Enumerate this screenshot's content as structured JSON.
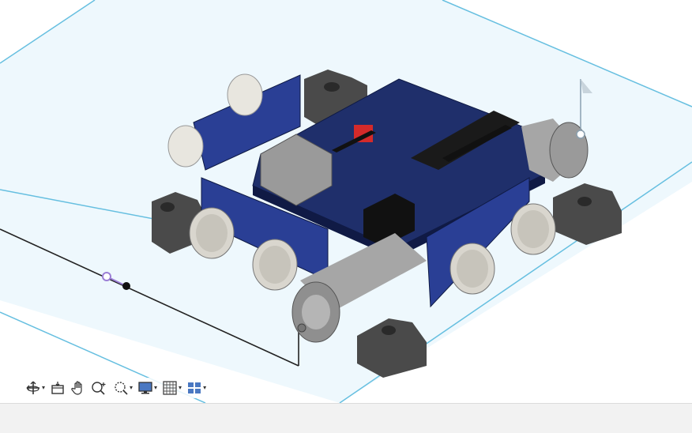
{
  "viewport": {
    "background_color": "#ffffff",
    "ground_plane_color": "#e9f6fc",
    "ground_plane_edge_color": "#5bb8dc",
    "model": {
      "board_color": "#1f2f6b",
      "sensor_color": "#e8e6df",
      "motor_color": "#a6a6a6",
      "wheel_mount_color": "#4a4a4a"
    }
  },
  "navigation_toolbar": {
    "tools": [
      {
        "icon": "orbit-icon",
        "dropdown": true
      },
      {
        "icon": "look-at-icon",
        "dropdown": false
      },
      {
        "icon": "pan-hand-icon",
        "dropdown": false
      },
      {
        "icon": "zoom-icon",
        "dropdown": false
      },
      {
        "icon": "fit-window-icon",
        "dropdown": true
      },
      {
        "icon": "display-settings-icon",
        "dropdown": true
      },
      {
        "icon": "grid-snaps-icon",
        "dropdown": true
      },
      {
        "icon": "viewports-icon",
        "dropdown": true
      }
    ]
  },
  "status_bar": {
    "background_color": "#f2f2f2"
  }
}
